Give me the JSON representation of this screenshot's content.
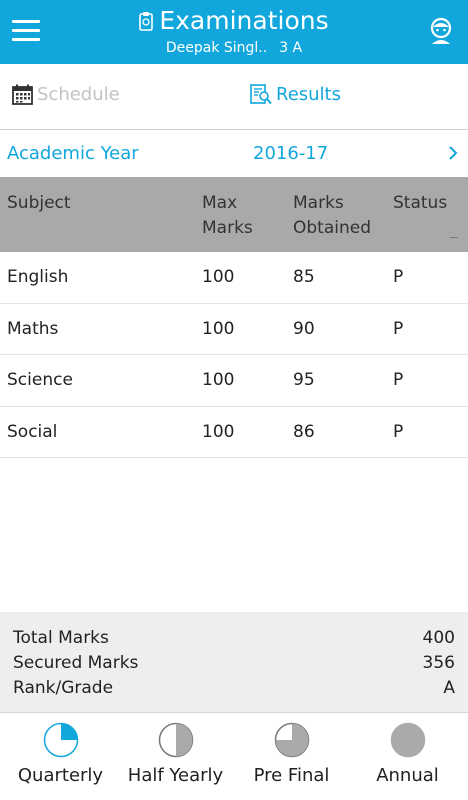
{
  "header": {
    "title": "Examinations",
    "student_name": "Deepak Singl..",
    "class": "3 A"
  },
  "tabs": [
    {
      "label": "Schedule",
      "active": false
    },
    {
      "label": "Results",
      "active": true
    }
  ],
  "academic_year": {
    "label": "Academic Year",
    "value": "2016-17"
  },
  "table": {
    "headers": {
      "subject": "Subject",
      "max_marks": "Max Marks",
      "marks_obtained": "Marks Obtained",
      "status": "Status"
    },
    "rows": [
      {
        "subject": "English",
        "max_marks": "100",
        "marks_obtained": "85",
        "status": "P"
      },
      {
        "subject": "Maths",
        "max_marks": "100",
        "marks_obtained": "90",
        "status": "P"
      },
      {
        "subject": "Science",
        "max_marks": "100",
        "marks_obtained": "95",
        "status": "P"
      },
      {
        "subject": "Social",
        "max_marks": "100",
        "marks_obtained": "86",
        "status": "P"
      }
    ]
  },
  "summary": {
    "total_marks": {
      "label": "Total Marks",
      "value": "400"
    },
    "secured_marks": {
      "label": "Secured Marks",
      "value": "356"
    },
    "rank_grade": {
      "label": "Rank/Grade",
      "value": "A"
    }
  },
  "bottom_nav": [
    {
      "label": "Quarterly",
      "active": true,
      "fill_fraction": 0.25
    },
    {
      "label": "Half Yearly",
      "active": false,
      "fill_fraction": 0.5
    },
    {
      "label": "Pre Final",
      "active": false,
      "fill_fraction": 0.75
    },
    {
      "label": "Annual",
      "active": false,
      "fill_fraction": 1.0
    }
  ],
  "colors": {
    "accent": "#11a7dd",
    "table_header_bg": "#a9a9a9",
    "summary_bg": "#eeeeee",
    "inactive_tab": "#c3c3c3",
    "icon_gray": "#aaaaaa"
  },
  "icons": {
    "menu": "hamburger-menu-icon",
    "title": "clipboard-icon",
    "avatar": "student-avatar-icon",
    "schedule": "calendar-icon",
    "results": "report-search-icon",
    "chevron": "chevron-right-icon"
  }
}
